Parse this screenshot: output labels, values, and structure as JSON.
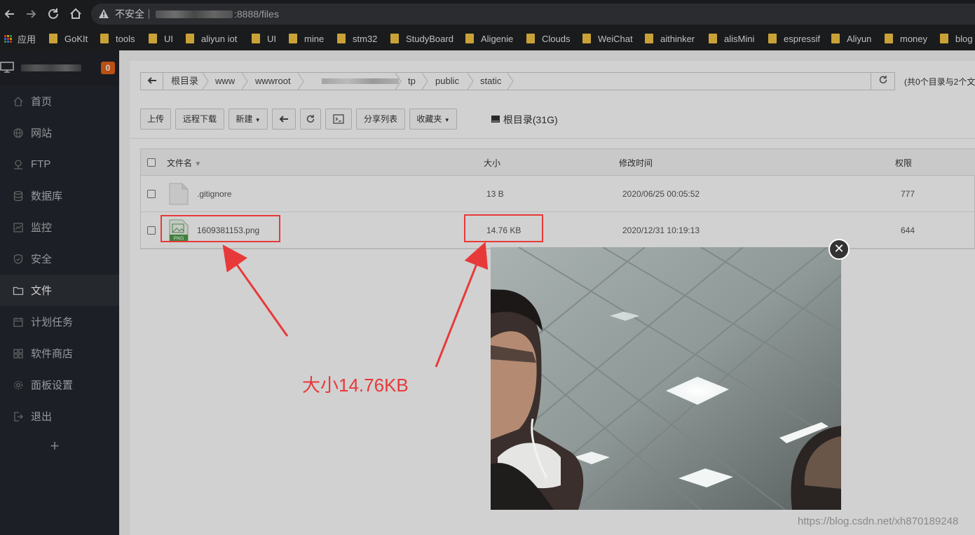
{
  "browser": {
    "security_label": "不安全",
    "url_suffix": ":8888/files",
    "bookmarks": [
      {
        "label": "应用"
      },
      {
        "label": "GoKIt"
      },
      {
        "label": "tools"
      },
      {
        "label": "UI"
      },
      {
        "label": "aliyun iot"
      },
      {
        "label": "UI"
      },
      {
        "label": "mine"
      },
      {
        "label": "stm32"
      },
      {
        "label": "StudyBoard"
      },
      {
        "label": "Aligenie"
      },
      {
        "label": "Clouds"
      },
      {
        "label": "WeiChat"
      },
      {
        "label": "aithinker"
      },
      {
        "label": "alisMini"
      },
      {
        "label": "espressif"
      },
      {
        "label": "Aliyun"
      },
      {
        "label": "money"
      },
      {
        "label": "blog"
      }
    ]
  },
  "sidebar": {
    "badge": "0",
    "items": [
      {
        "label": "首页",
        "icon": "home-icon"
      },
      {
        "label": "网站",
        "icon": "globe-icon"
      },
      {
        "label": "FTP",
        "icon": "ftp-icon"
      },
      {
        "label": "数据库",
        "icon": "database-icon"
      },
      {
        "label": "监控",
        "icon": "monitor-chart-icon"
      },
      {
        "label": "安全",
        "icon": "shield-icon"
      },
      {
        "label": "文件",
        "icon": "folder-icon"
      },
      {
        "label": "计划任务",
        "icon": "calendar-icon"
      },
      {
        "label": "软件商店",
        "icon": "apps-icon"
      },
      {
        "label": "面板设置",
        "icon": "gear-icon"
      },
      {
        "label": "退出",
        "icon": "logout-icon"
      }
    ],
    "active_index": 6,
    "add_symbol": "+"
  },
  "path": {
    "crumbs": [
      "根目录",
      "www",
      "wwwroot",
      "tp",
      "public",
      "static"
    ],
    "summary": "(共0个目录与2个文"
  },
  "toolbar": {
    "upload": "上传",
    "remote_download": "远程下载",
    "new": "新建",
    "share_list": "分享列表",
    "favorites": "收藏夹",
    "disk": "根目录(31G)"
  },
  "table": {
    "headers": {
      "name": "文件名",
      "size": "大小",
      "mtime": "修改时间",
      "perm": "权限"
    },
    "rows": [
      {
        "name": ".gitignore",
        "size": "13 B",
        "mtime": "2020/06/25 00:05:52",
        "perm": "777",
        "icon": "file-icon"
      },
      {
        "name": "1609381153.png",
        "size": "14.76 KB",
        "mtime": "2020/12/31 10:19:13",
        "perm": "644",
        "icon": "png-file-icon",
        "icon_tag": "PNG"
      }
    ]
  },
  "annotation": {
    "text": "大小14.76KB",
    "color": "#e8393a"
  },
  "preview": {
    "close_symbol": "✕"
  },
  "watermark": "https://blog.csdn.net/xh870189248"
}
